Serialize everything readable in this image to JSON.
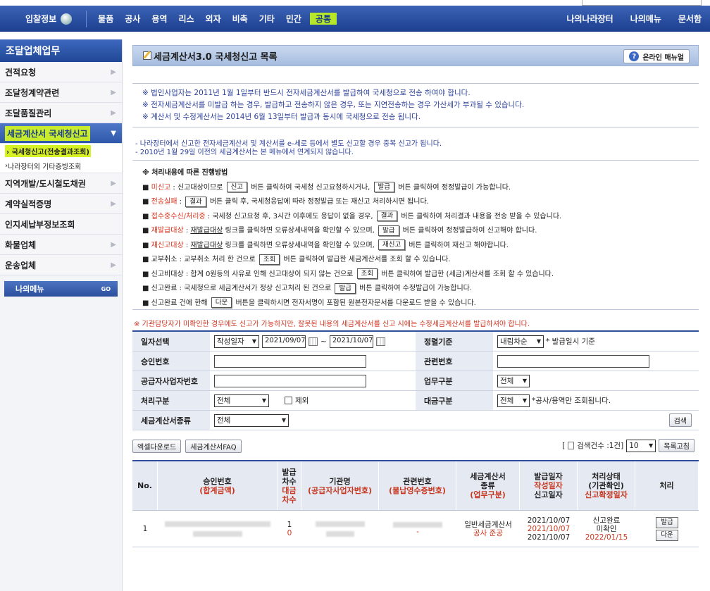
{
  "nav": {
    "home": "입찰정보",
    "categories": [
      "물품",
      "공사",
      "용역",
      "리스",
      "외자",
      "비축",
      "기타",
      "민간",
      "공통"
    ],
    "right": [
      "나의나라장터",
      "나의메뉴",
      "문서함"
    ]
  },
  "sidebar": {
    "title": "조달업체업무",
    "items": [
      "견적요청",
      "조달청계약관련",
      "조달품질관리",
      "세금계산서 국세청신고"
    ],
    "subitems": [
      "국세청신고(전송결과조회)",
      "나라장터외 기타증빙조회"
    ],
    "items2": [
      "지역개발/도시철도채권",
      "계약실적증명",
      "인지세납부정보조회",
      "화물업체",
      "운송업체"
    ],
    "my_menu": "나의메뉴",
    "go": "GO"
  },
  "header": {
    "title": "세금계산서3.0 국세청신고 목록",
    "manual": "온라인 매뉴얼"
  },
  "notice1": [
    "※ 법인사업자는 2011년 1월 1일부터 반드시 전자세금계산서를 발급하여 국세청으로 전송 하여야 합니다.",
    "※ 전자세금계산서를 미발급 하는 경우, 발급하고 전송하지 않은 경우, 또는 지연전송하는 경우 가산세가 부과될 수 있습니다.",
    "※ 계산서 및 수정계산서는 2014년 6월 13일부터 발급과 동시에 국세청으로 전송 됩니다."
  ],
  "notice2": [
    "- 나라장터에서 신고한 전자세금계산서 및 계산서를 e-세로 등에서 별도 신고할 경우 중복 신고가 됩니다.",
    "- 2010년 1월 29일 이전의 세금계산서는 본 메뉴에서 연계되지 않습니다."
  ],
  "process": {
    "title": "※ 처리내용에 따른 진행방법",
    "lines": [
      {
        "pre": "■ ",
        "key": "미신고",
        "mid": " : 신고대상이므로 ",
        "btn1": "신고",
        "mid2": " 버튼 클릭하여 국세청 신고요청하시거나, ",
        "btn2": "발급",
        "post": " 버튼 클릭하여 정정발급이 가능합니다."
      },
      {
        "pre": "■ ",
        "key": "전송실패",
        "mid": " : ",
        "btn1": "결과",
        "mid2": " 버튼 클릭 후, 국세청응답에 따라 정정발급 또는 재신고 처리하시면 됩니다.",
        "btn2": "",
        "post": ""
      },
      {
        "pre": "■ ",
        "key": "접수중수신/처리중",
        "mid": " : 국세청 신고요청 후, 3시간 이후에도 응답이 없을 경우, ",
        "btn1": "결과",
        "mid2": " 버튼 클릭하여 처리결과 내용을 전송 받을 수 있습니다.",
        "btn2": "",
        "post": ""
      },
      {
        "pre": "■ ",
        "key": "재발급대상",
        "mid": " : ",
        "link": "재발급대상",
        "mid3": " 링크를 클릭하면 오류상세내역을 확인할 수 있으며, ",
        "btn1": "발급",
        "mid2": " 버튼 클릭하여 정정발급하여 신고해야 합니다.",
        "btn2": "",
        "post": ""
      },
      {
        "pre": "■ ",
        "key": "재신고대상",
        "mid": " : ",
        "link": "재발급대상",
        "mid3": " 링크를 클릭하면 오류상세내역을 확인할 수 있으며, ",
        "btn1": "재신고",
        "mid2": " 버튼 클릭하여 재신고 해야합니다.",
        "btn2": "",
        "post": ""
      },
      {
        "pre": "■ ",
        "plain": "교부취소 : 교부취소 처리 한 건으로 ",
        "btn1": "조회",
        "mid2": " 버튼 클릭하여 발급한 세금계산서를 조회 할 수 있습니다."
      },
      {
        "pre": "■ ",
        "plain": "신고비대상 : 합계 0원등의 사유로 인해 신고대상이 되지 않는 건으로 ",
        "btn1": "조회",
        "mid2": " 버튼 클릭하여 발급한 (세금)계산서를 조회 할 수 있습니다."
      },
      {
        "pre": "■ ",
        "plain": "신고완료 : 국세청으로 세금계산서가 정상 신고처리 된 건으로 ",
        "btn1": "발급",
        "mid2": " 버튼 클릭하여 수정발급이 가능합니다."
      },
      {
        "pre": "■ ",
        "plain": "신고완료 건에 한해 ",
        "btn1": "다운",
        "mid2": " 버튼을 클릭하시면 전자서명이 포함된 원본전자문서를 다운로드 받을 수 있습니다."
      }
    ]
  },
  "warning": "※ 기관담당자가 미확인한 경우에도 신고가 가능하지만, 잘못된 내용의 세금계산서를 신고 시에는 수정세금계산서를 발급하셔야 합니다.",
  "form": {
    "date_label": "일자선택",
    "date_type": "작성일자",
    "date_from": "2021/09/07",
    "tilde": "~",
    "date_to": "2021/10/07",
    "sort_label": "정렬기준",
    "sort_value": "내림차순",
    "sort_note": "* 발급일시 기준",
    "approval_label": "승인번호",
    "related_label": "관련번호",
    "supplier_label": "공급자사업자번호",
    "biz_label": "업무구분",
    "biz_value": "전체",
    "proc_label": "처리구분",
    "proc_value": "전체",
    "exclude": "제외",
    "class_label": "대금구분",
    "class_value": "전체",
    "class_note": "*공사/용역만 조회됩니다.",
    "type_label": "세금계산서종류",
    "type_value": "전체",
    "search_btn": "검색"
  },
  "tools": {
    "excel": "엑셀다운로드",
    "faq": "세금계산서FAQ",
    "count_pre": "[",
    "count": "검색건수 :1건]",
    "page_size": "10",
    "refresh": "목록고침"
  },
  "table": {
    "headers": {
      "no": "No.",
      "approval": "승인번호",
      "approval_sub": "(합계금액)",
      "issue1": "발급",
      "issue2": "차수",
      "issue3": "대금",
      "issue4": "차수",
      "agency": "기관명",
      "agency_sub": "(공급자사업자번호)",
      "related": "관련번호",
      "related_sub": "(물납영수증번호)",
      "kind1": "세금계산서",
      "kind2": "종류",
      "kind3": "(업무구분)",
      "date1": "발급일자",
      "date2": "작성일자",
      "date3": "신고일자",
      "status1": "처리상태",
      "status2": "(기관확인)",
      "status3": "신고확정일자",
      "action": "처리"
    },
    "rows": [
      {
        "no": "1",
        "issue": "1",
        "payment": "0",
        "related_dash": "-",
        "kind": "일반세금계산서",
        "biz": "공사 준공",
        "issue_date": "2021/10/07",
        "write_date": "2021/10/07",
        "report_date": "2021/10/07",
        "status": "신고완료",
        "confirm": "미확인",
        "final_date": "2022/01/15",
        "btn_issue": "발급",
        "btn_down": "다운"
      }
    ]
  }
}
